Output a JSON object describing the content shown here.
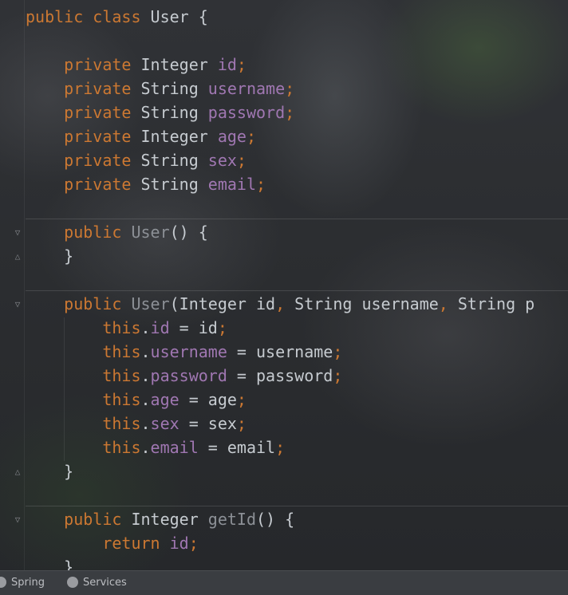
{
  "editor": {
    "lines": [
      {
        "tokens": [
          [
            "kw",
            "public "
          ],
          [
            "kw",
            "class "
          ],
          [
            "ty",
            "User "
          ],
          [
            "p",
            "{"
          ]
        ]
      },
      {
        "tokens": []
      },
      {
        "tokens": [
          [
            "kw",
            "    private "
          ],
          [
            "ty",
            "Integer "
          ],
          [
            "fld",
            "id"
          ],
          [
            "sc",
            ";"
          ]
        ]
      },
      {
        "tokens": [
          [
            "kw",
            "    private "
          ],
          [
            "ty",
            "String "
          ],
          [
            "fld",
            "username"
          ],
          [
            "sc",
            ";"
          ]
        ]
      },
      {
        "tokens": [
          [
            "kw",
            "    private "
          ],
          [
            "ty",
            "String "
          ],
          [
            "fld",
            "password"
          ],
          [
            "sc",
            ";"
          ]
        ]
      },
      {
        "tokens": [
          [
            "kw",
            "    private "
          ],
          [
            "ty",
            "Integer "
          ],
          [
            "fld",
            "age"
          ],
          [
            "sc",
            ";"
          ]
        ]
      },
      {
        "tokens": [
          [
            "kw",
            "    private "
          ],
          [
            "ty",
            "String "
          ],
          [
            "fld",
            "sex"
          ],
          [
            "sc",
            ";"
          ]
        ]
      },
      {
        "tokens": [
          [
            "kw",
            "    private "
          ],
          [
            "ty",
            "String "
          ],
          [
            "fld",
            "email"
          ],
          [
            "sc",
            ";"
          ]
        ]
      },
      {
        "tokens": []
      },
      {
        "tokens": [
          [
            "kw",
            "    public "
          ],
          [
            "fn",
            "User"
          ],
          [
            "p",
            "() {"
          ]
        ]
      },
      {
        "tokens": [
          [
            "p",
            "    }"
          ]
        ]
      },
      {
        "tokens": []
      },
      {
        "tokens": [
          [
            "kw",
            "    public "
          ],
          [
            "fn",
            "User"
          ],
          [
            "p",
            "(Integer id"
          ],
          [
            "sc",
            ", "
          ],
          [
            "p",
            "String username"
          ],
          [
            "sc",
            ", "
          ],
          [
            "p",
            "String p"
          ]
        ]
      },
      {
        "tokens": [
          [
            "this",
            "        this"
          ],
          [
            "p",
            "."
          ],
          [
            "fld",
            "id"
          ],
          [
            "p",
            " = id"
          ],
          [
            "sc",
            ";"
          ]
        ]
      },
      {
        "tokens": [
          [
            "this",
            "        this"
          ],
          [
            "p",
            "."
          ],
          [
            "fld",
            "username"
          ],
          [
            "p",
            " = username"
          ],
          [
            "sc",
            ";"
          ]
        ]
      },
      {
        "tokens": [
          [
            "this",
            "        this"
          ],
          [
            "p",
            "."
          ],
          [
            "fld",
            "password"
          ],
          [
            "p",
            " = password"
          ],
          [
            "sc",
            ";"
          ]
        ]
      },
      {
        "tokens": [
          [
            "this",
            "        this"
          ],
          [
            "p",
            "."
          ],
          [
            "fld",
            "age"
          ],
          [
            "p",
            " = age"
          ],
          [
            "sc",
            ";"
          ]
        ]
      },
      {
        "tokens": [
          [
            "this",
            "        this"
          ],
          [
            "p",
            "."
          ],
          [
            "fld",
            "sex"
          ],
          [
            "p",
            " = sex"
          ],
          [
            "sc",
            ";"
          ]
        ]
      },
      {
        "tokens": [
          [
            "this",
            "        this"
          ],
          [
            "p",
            "."
          ],
          [
            "fld",
            "email"
          ],
          [
            "p",
            " = email"
          ],
          [
            "sc",
            ";"
          ]
        ]
      },
      {
        "tokens": [
          [
            "p",
            "    }"
          ]
        ]
      },
      {
        "tokens": []
      },
      {
        "tokens": [
          [
            "kw",
            "    public "
          ],
          [
            "ty",
            "Integer "
          ],
          [
            "fn",
            "getId"
          ],
          [
            "p",
            "() {"
          ]
        ]
      },
      {
        "tokens": [
          [
            "kw",
            "        return "
          ],
          [
            "fld",
            "id"
          ],
          [
            "sc",
            ";"
          ]
        ]
      },
      {
        "tokens": [
          [
            "p",
            "    }"
          ]
        ]
      }
    ]
  },
  "statusbar": {
    "spring_label": "Spring",
    "spring_icon": "spring-icon",
    "services_label": "Services",
    "services_icon": "play-circle-icon"
  }
}
